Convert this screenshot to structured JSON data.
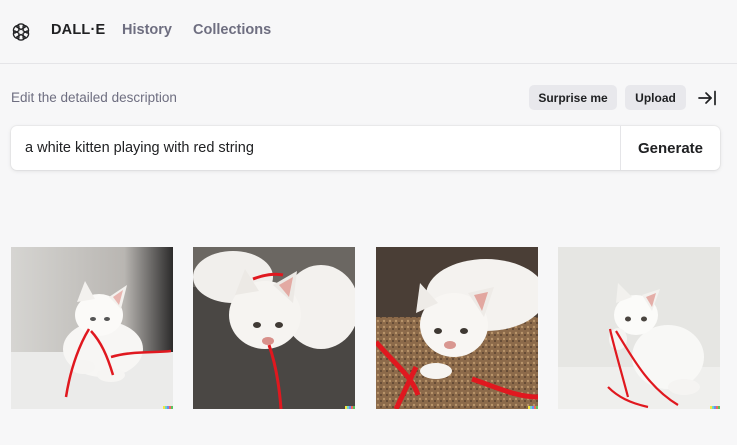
{
  "header": {
    "logo_icon": "openai-logo-icon",
    "brand": "DALL·E",
    "nav": [
      {
        "label": "History"
      },
      {
        "label": "Collections"
      }
    ]
  },
  "editor": {
    "label": "Edit the detailed description",
    "surprise_label": "Surprise me",
    "upload_label": "Upload",
    "collapse_icon": "arrow-right-to-bar-icon",
    "prompt_value": "a white kitten playing with red string",
    "generate_label": "Generate"
  },
  "results": {
    "count_shown": 4,
    "accent_color": "#e8202a",
    "signature_colors": [
      "#f5e642",
      "#6fd9c4",
      "#6b8cf7",
      "#f26b5b",
      "#58c461"
    ]
  }
}
